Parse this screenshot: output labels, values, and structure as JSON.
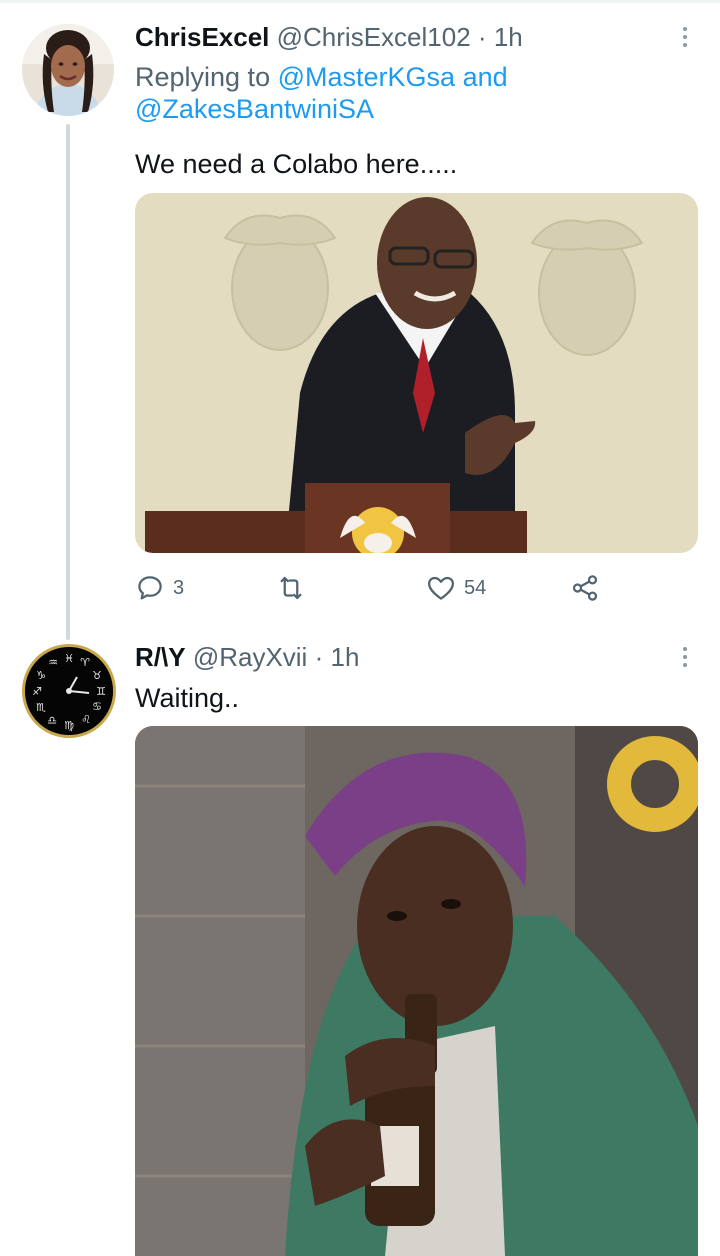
{
  "tweet1": {
    "display_name": "ChrisExcel",
    "handle": "@ChrisExcel102",
    "separator": "·",
    "time": "1h",
    "replying_prefix": "Replying to",
    "replying_user1": "@MasterKGsa",
    "replying_and": "and",
    "replying_user2": "@ZakesBantwiniSA",
    "text": "We need a Colabo here.....",
    "avatar_icon": "profile-photo",
    "actions": {
      "reply_count": "3",
      "retweet_count": "",
      "like_count": "54"
    }
  },
  "tweet2": {
    "display_name": "R/\\Y",
    "handle": "@RayXvii",
    "separator": "·",
    "time": "1h",
    "text": "Waiting..",
    "avatar_icon": "zodiac-clock"
  },
  "colors": {
    "link": "#1d9bf0",
    "muted": "#536471",
    "text": "#0f1419",
    "thread_line": "#cfd9de"
  }
}
